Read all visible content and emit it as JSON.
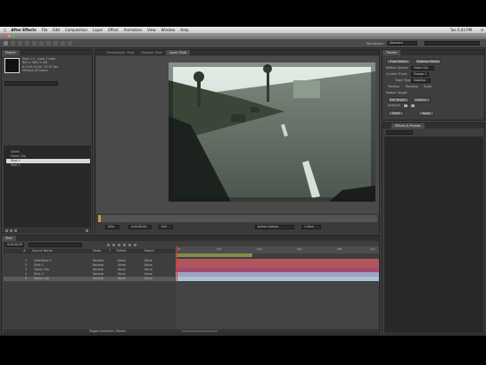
{
  "menubar": {
    "apple": "",
    "app_name": "After Effects",
    "items": [
      "File",
      "Edit",
      "Composition",
      "Layer",
      "Effect",
      "Animation",
      "View",
      "Window",
      "Help"
    ],
    "clock": "Tue 5:43 PM"
  },
  "window": {
    "title": ""
  },
  "workspace": {
    "label": "Workspace:",
    "value": "Standard"
  },
  "project": {
    "tab": "Project",
    "info_line1": "Shot 1 ▾ , used 1 time",
    "info_line2": "640 x 360 (1.00)",
    "info_line3": "Δ 0;00;10;00, 29.97 fps",
    "info_line4": "Millions of Colors",
    "search_placeholder": "",
    "items": [
      "Solids",
      "Video Clip",
      "Shot 1",
      "Shot 2"
    ],
    "selected_index": 2
  },
  "viewer": {
    "tabs": [
      "Composition: Shot",
      "Footage: Shot",
      "Layer: Shot"
    ],
    "active_tab": 2,
    "zoom": "50%",
    "timecode": "0;00;00;00",
    "res": "Full",
    "view": "Active Camera",
    "view_mode": "1 View"
  },
  "tracker": {
    "tab": "Tracker",
    "buttons": [
      "Track Motion",
      "Stabilize Motion"
    ],
    "labels": [
      "Motion Source:",
      "Current Track:",
      "Track Type:"
    ],
    "values": [
      "Video Clip",
      "Tracker 1",
      "Stabilize"
    ],
    "checks": [
      "Position",
      "Rotation",
      "Scale"
    ],
    "motion_target_label": "Motion Target:",
    "edit_target": "Edit Target...",
    "options": "Options...",
    "analyze_label": "Analyze:",
    "reset": "Reset",
    "apply": "Apply"
  },
  "effects": {
    "tab": "Effects & Presets",
    "search_placeholder": "",
    "items": [
      "* Animation Presets",
      "3D Channel",
      "Audio",
      "Blur & Sharpen",
      "Channel",
      "Color Correction",
      "Distort",
      "Expression Controls",
      "Generate",
      "Keying",
      "Matte",
      "Noise & Grain"
    ]
  },
  "timeline": {
    "tab": "Shot",
    "timecode": "0;00;00;00",
    "col_headers": [
      "#",
      "Source Name",
      "Mode",
      "T",
      "TrkMat",
      "Parent"
    ],
    "layers": [
      {
        "num": "1",
        "name": "Stabilized 2",
        "mode": "Normal",
        "trkmat": "None",
        "parent": "None"
      },
      {
        "num": "2",
        "name": "Shot 1",
        "mode": "Normal",
        "trkmat": "None",
        "parent": "None"
      },
      {
        "num": "3",
        "name": "Video Clip",
        "mode": "Normal",
        "trkmat": "None",
        "parent": "None"
      },
      {
        "num": "4",
        "name": "Shot 2",
        "mode": "Normal",
        "trkmat": "None",
        "parent": "None"
      },
      {
        "num": "5",
        "name": "Video Clip",
        "mode": "Normal",
        "trkmat": "None",
        "parent": "None"
      }
    ],
    "ruler_labels": [
      "0s",
      "02s",
      "04s",
      "06s",
      "08s",
      "10s"
    ],
    "toggle_label": "Toggle Switches / Modes"
  },
  "colors": {
    "layer_bars": [
      "#b0575e",
      "#b0575e",
      "#a4496f",
      "#9ba3c0",
      "#a9c2d3"
    ],
    "orange": "#d49a2b",
    "work_area": "#8a8a4a"
  }
}
